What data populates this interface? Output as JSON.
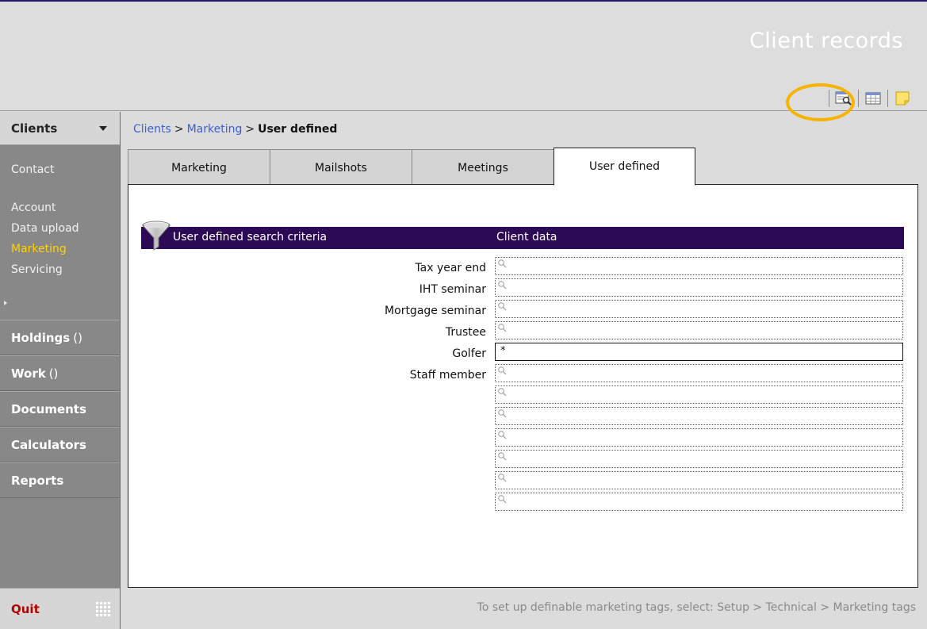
{
  "header": {
    "title": "Client records"
  },
  "toolbar": {
    "icons": [
      "search-window-icon",
      "table-view-icon",
      "sticky-note-icon"
    ]
  },
  "sidebar": {
    "head_label": "Clients",
    "sub_items": [
      {
        "label": "Contact",
        "active": false
      },
      {
        "label": "Account",
        "active": false
      },
      {
        "label": "Data upload",
        "active": false
      },
      {
        "label": "Marketing",
        "active": true
      },
      {
        "label": "Servicing",
        "active": false
      }
    ],
    "sections": [
      {
        "label": "Holdings",
        "count": "()"
      },
      {
        "label": "Work",
        "count": "()"
      },
      {
        "label": "Documents",
        "count": ""
      },
      {
        "label": "Calculators",
        "count": ""
      },
      {
        "label": "Reports",
        "count": ""
      }
    ],
    "quit_label": "Quit"
  },
  "breadcrumb": {
    "part1": "Clients",
    "sep": ">",
    "part2": "Marketing",
    "current": "User defined"
  },
  "tabs": [
    {
      "label": "Marketing",
      "active": false
    },
    {
      "label": "Mailshots",
      "active": false
    },
    {
      "label": "Meetings",
      "active": false
    },
    {
      "label": "User defined",
      "active": true
    }
  ],
  "grid": {
    "left_header": "User defined search criteria",
    "right_header": "Client data",
    "rows": [
      {
        "label": "Tax year end",
        "value": ""
      },
      {
        "label": "IHT seminar",
        "value": ""
      },
      {
        "label": "Mortgage seminar",
        "value": ""
      },
      {
        "label": "Trustee",
        "value": ""
      },
      {
        "label": "Golfer",
        "value": "*"
      },
      {
        "label": "Staff member",
        "value": ""
      },
      {
        "label": "",
        "value": ""
      },
      {
        "label": "",
        "value": ""
      },
      {
        "label": "",
        "value": ""
      },
      {
        "label": "",
        "value": ""
      },
      {
        "label": "",
        "value": ""
      },
      {
        "label": "",
        "value": ""
      }
    ]
  },
  "footer": {
    "hint": "To set up definable marketing tags, select: Setup > Technical > Marketing tags"
  },
  "colors": {
    "header_bar": "#2c0a55",
    "active_nav": "#ffd200",
    "highlight": "#f7b300",
    "quit": "#b30000"
  }
}
